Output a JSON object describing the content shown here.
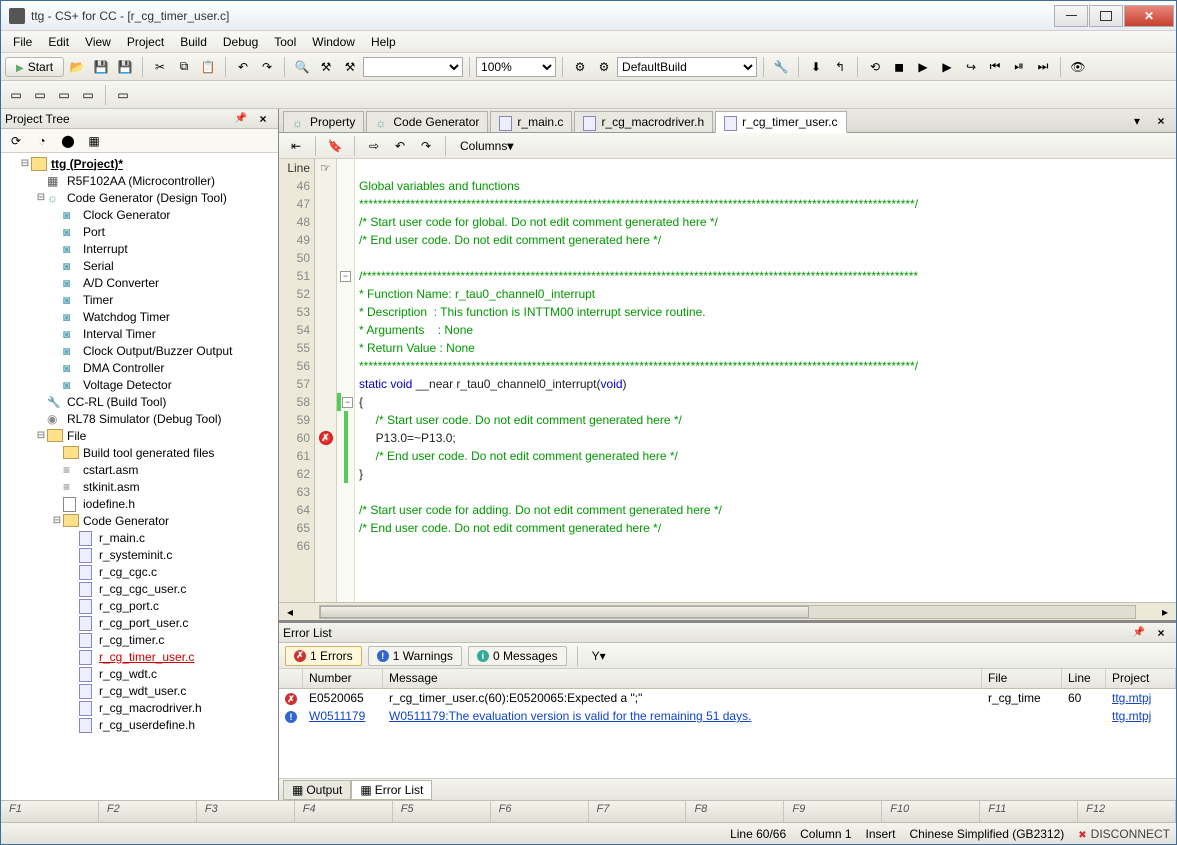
{
  "window": {
    "title": "ttg - CS+ for CC - [r_cg_timer_user.c]"
  },
  "menu": {
    "file": "File",
    "edit": "Edit",
    "view": "View",
    "project": "Project",
    "build": "Build",
    "debug": "Debug",
    "tool": "Tool",
    "window": "Window",
    "help": "Help"
  },
  "toolbar": {
    "start": "Start",
    "zoom": "100%",
    "buildcfg": "DefaultBuild"
  },
  "projectTree": {
    "title": "Project Tree",
    "root": "ttg (Project)*",
    "mcu": "R5F102AA (Microcontroller)",
    "codegen": "Code Generator (Design Tool)",
    "cg_items": [
      "Clock Generator",
      "Port",
      "Interrupt",
      "Serial",
      "A/D Converter",
      "Timer",
      "Watchdog Timer",
      "Interval Timer",
      "Clock Output/Buzzer Output",
      "DMA Controller",
      "Voltage Detector"
    ],
    "ccrl": "CC-RL (Build Tool)",
    "sim": "RL78 Simulator (Debug Tool)",
    "fileNode": "File",
    "genFiles": "Build tool generated files",
    "files1": [
      "cstart.asm",
      "stkinit.asm",
      "iodefine.h"
    ],
    "cgfolder": "Code Generator",
    "cgfiles": [
      "r_main.c",
      "r_systeminit.c",
      "r_cg_cgc.c",
      "r_cg_cgc_user.c",
      "r_cg_port.c",
      "r_cg_port_user.c",
      "r_cg_timer.c",
      "r_cg_timer_user.c",
      "r_cg_wdt.c",
      "r_cg_wdt_user.c",
      "r_cg_macrodriver.h",
      "r_cg_userdefine.h"
    ]
  },
  "editor": {
    "tabs": {
      "property": "Property",
      "codegen": "Code Generator",
      "main": "r_main.c",
      "macro": "r_cg_macrodriver.h",
      "active": "r_cg_timer_user.c"
    },
    "columns": "Columns",
    "lineHeader": "Line",
    "lines": {
      "l46": "Global variables and functions",
      "l47": "***********************************************************************************************************************/",
      "l48": "/* Start user code for global. Do not edit comment generated here */",
      "l49": "/* End user code. Do not edit comment generated here */",
      "l51": "/***********************************************************************************************************************",
      "l52": "* Function Name: r_tau0_channel0_interrupt",
      "l53": "* Description  : This function is INTTM00 interrupt service routine.",
      "l54": "* Arguments    : None",
      "l55": "* Return Value : None",
      "l56": "***********************************************************************************************************************/",
      "l57a": "static ",
      "l57b": "void ",
      "l57c": "__near r_tau0_channel0_interrupt(",
      "l57d": "void",
      "l57e": ")",
      "l58": "{",
      "l59": "    /* Start user code. Do not edit comment generated here */",
      "l60": "    P13.0=~P13.0;",
      "l61": "    /* End user code. Do not edit comment generated here */",
      "l62": "}",
      "l64": "/* Start user code for adding. Do not edit comment generated here */",
      "l65": "/* End user code. Do not edit comment generated here */"
    },
    "lineNums": [
      "46",
      "47",
      "48",
      "49",
      "50",
      "51",
      "52",
      "53",
      "54",
      "55",
      "56",
      "57",
      "58",
      "59",
      "60",
      "61",
      "62",
      "63",
      "64",
      "65",
      "66"
    ]
  },
  "errorPanel": {
    "title": "Error List",
    "filters": {
      "errors": "1 Errors",
      "warnings": "1 Warnings",
      "messages": "0 Messages"
    },
    "headers": {
      "number": "Number",
      "message": "Message",
      "file": "File",
      "line": "Line",
      "project": "Project"
    },
    "rows": [
      {
        "icon": "error",
        "num": "E0520065",
        "msg": "r_cg_timer_user.c(60):E0520065:Expected a \";\"",
        "file": "r_cg_time",
        "line": "60",
        "proj": "ttg.mtpj",
        "link": false
      },
      {
        "icon": "warn",
        "num": "W0511179",
        "msg": "W0511179:The evaluation version is valid for the remaining 51 days.",
        "file": "",
        "line": "",
        "proj": "ttg.mtpj",
        "link": true
      }
    ],
    "bottomTabs": {
      "output": "Output",
      "errorlist": "Error List"
    }
  },
  "fkeys": [
    "F1",
    "F2",
    "F3",
    "F4",
    "F5",
    "F6",
    "F7",
    "F8",
    "F9",
    "F10",
    "F11",
    "F12"
  ],
  "status": {
    "pos": "Line 60/66",
    "col": "Column 1",
    "mode": "Insert",
    "enc": "Chinese Simplified (GB2312)",
    "conn": "DISCONNECT"
  }
}
